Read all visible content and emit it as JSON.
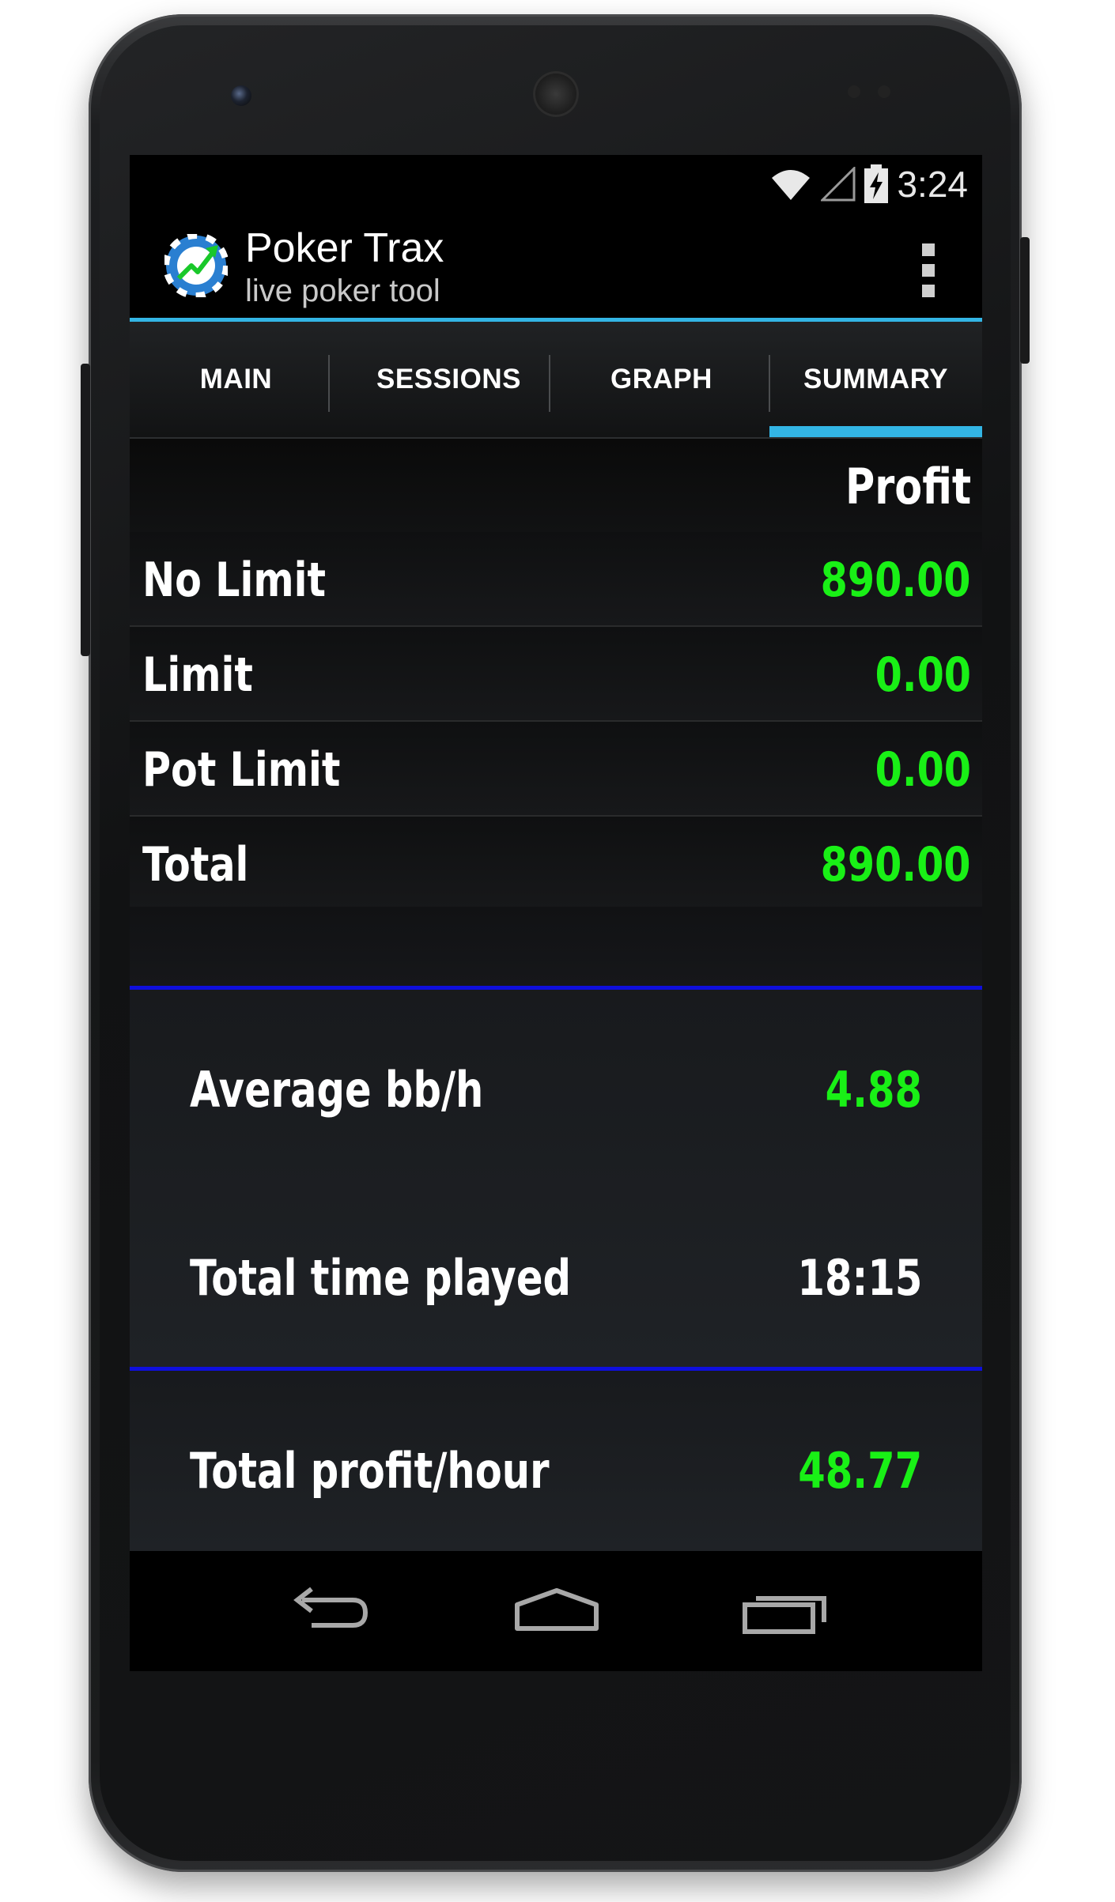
{
  "status_bar": {
    "time": "3:24",
    "icons": [
      "wifi-icon",
      "signal-icon",
      "battery-charging-icon"
    ]
  },
  "action_bar": {
    "title": "Poker Trax",
    "subtitle": "live poker tool",
    "app_icon": "poker-chip-chart-icon",
    "overflow_icon": "overflow-menu-icon"
  },
  "tabs": [
    {
      "label": "MAIN",
      "selected": false
    },
    {
      "label": "SESSIONS",
      "selected": false
    },
    {
      "label": "GRAPH",
      "selected": false
    },
    {
      "label": "SUMMARY",
      "selected": true
    }
  ],
  "summary": {
    "header": "Profit",
    "rows": [
      {
        "label": "No Limit",
        "value": "890.00"
      },
      {
        "label": "Limit",
        "value": "0.00"
      },
      {
        "label": "Pot Limit",
        "value": "0.00"
      },
      {
        "label": "Total",
        "value": "890.00"
      }
    ],
    "stats": [
      {
        "label": "Average bb/h",
        "value": "4.88",
        "color": "#19f016"
      },
      {
        "label": "Total time played",
        "value": "18:15",
        "color": "#ffffff"
      },
      {
        "label": "Total profit/hour",
        "value": "48.77",
        "color": "#19f016"
      }
    ]
  },
  "nav_bar": {
    "icons": [
      "back-icon",
      "home-icon",
      "recents-icon"
    ]
  },
  "colors": {
    "accent": "#33b5e5",
    "positive": "#19f016",
    "divider_blue": "#0f0fdd"
  }
}
